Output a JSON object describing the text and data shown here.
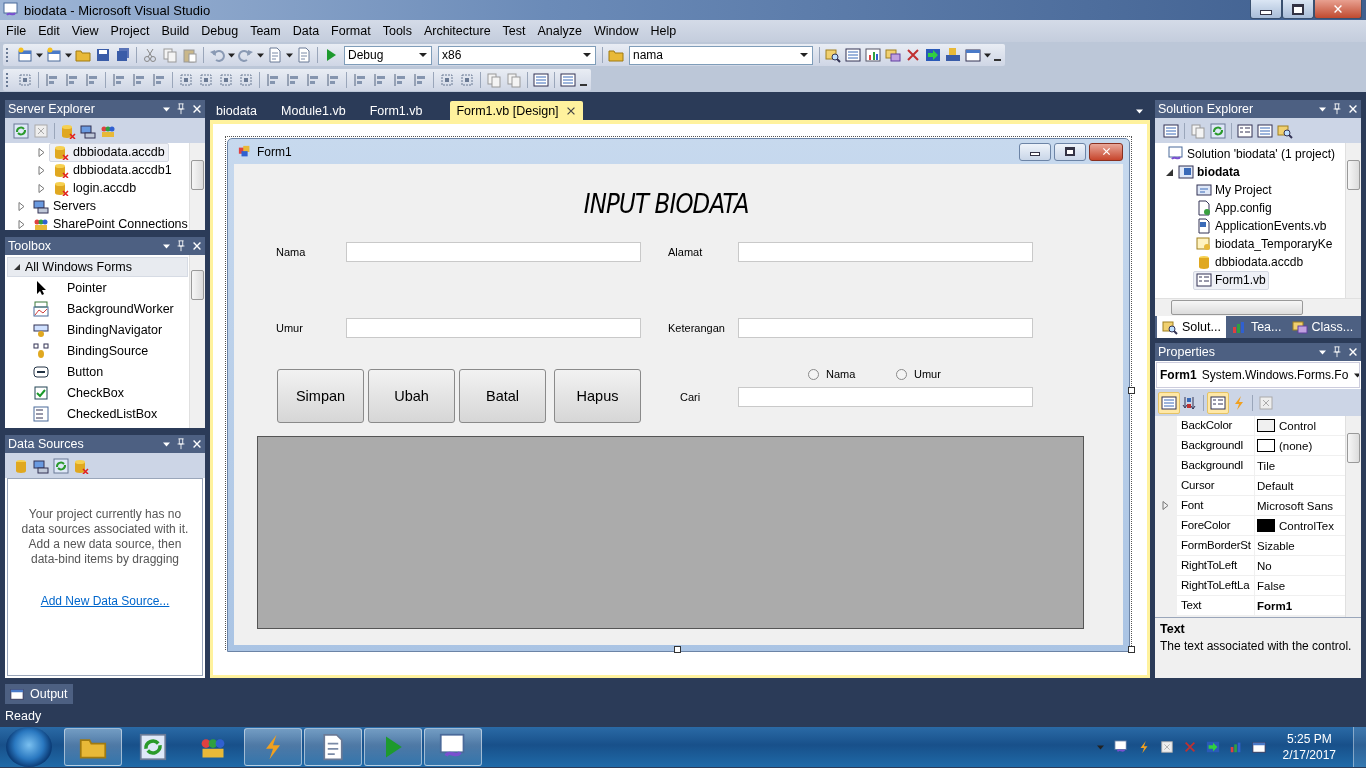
{
  "window": {
    "title": "biodata - Microsoft Visual Studio"
  },
  "menu": [
    "File",
    "Edit",
    "View",
    "Project",
    "Build",
    "Debug",
    "Team",
    "Data",
    "Format",
    "Tools",
    "Architecture",
    "Test",
    "Analyze",
    "Window",
    "Help"
  ],
  "toolbar": {
    "configuration": "Debug",
    "platform": "x86",
    "find": "nama"
  },
  "server_explorer": {
    "title": "Server Explorer",
    "items": [
      {
        "children": [
          {
            "label": "dbbiodata.accdb",
            "kind": "database",
            "expanded": false,
            "selected": true
          },
          {
            "label": "dbbiodata.accdb1",
            "kind": "database",
            "expanded": false,
            "selected": false
          },
          {
            "label": "login.accdb",
            "kind": "database",
            "expanded": false,
            "selected": false
          }
        ]
      },
      {
        "label": "Servers",
        "kind": "servers",
        "expanded": false,
        "selected": false
      },
      {
        "label": "SharePoint Connections",
        "kind": "sharepoint",
        "expanded": false,
        "selected": false
      }
    ]
  },
  "toolbox": {
    "title": "Toolbox",
    "category": {
      "label": "All Windows Forms",
      "expanded": true
    },
    "items": [
      {
        "label": "Pointer",
        "kind": "pointer"
      },
      {
        "label": "BackgroundWorker",
        "kind": "worker"
      },
      {
        "label": "BindingNavigator",
        "kind": "navigator"
      },
      {
        "label": "BindingSource",
        "kind": "source"
      },
      {
        "label": "Button",
        "kind": "button"
      },
      {
        "label": "CheckBox",
        "kind": "checkbox"
      },
      {
        "label": "CheckedListBox",
        "kind": "listbox"
      }
    ]
  },
  "data_sources": {
    "title": "Data Sources",
    "message": "Your project currently has no data sources associated with it. Add a new data source, then data-bind items by dragging",
    "link": "Add New Data Source..."
  },
  "editor_tabs": [
    {
      "label": "biodata",
      "selected": false
    },
    {
      "label": "Module1.vb",
      "selected": false
    },
    {
      "label": "Form1.vb",
      "selected": false
    },
    {
      "label": "Form1.vb [Design]",
      "selected": true
    }
  ],
  "form": {
    "title": "Form1",
    "heading": "INPUT BIODATA",
    "fields": [
      {
        "label": "Nama"
      },
      {
        "label": "Alamat"
      },
      {
        "label": "Umur"
      },
      {
        "label": "Keterangan"
      }
    ],
    "buttons": [
      "Simpan",
      "Ubah",
      "Batal",
      "Hapus"
    ],
    "radios": [
      {
        "label": "Nama",
        "selected": false
      },
      {
        "label": "Umur",
        "selected": false
      }
    ],
    "search_label": "Cari"
  },
  "solution_explorer": {
    "title": "Solution Explorer",
    "items": [
      {
        "label": "Solution 'biodata' (1 project)",
        "kind": "solution",
        "selected": false,
        "children": [
          {
            "label": "biodata",
            "kind": "project",
            "expanded": true,
            "selected": false,
            "children": [
              {
                "label": "My Project",
                "kind": "myproject",
                "selected": false
              },
              {
                "label": "App.config",
                "kind": "config",
                "selected": false
              },
              {
                "label": "ApplicationEvents.vb",
                "kind": "vbfile",
                "selected": false
              },
              {
                "label": "biodata_TemporaryKe",
                "kind": "key",
                "selected": false
              },
              {
                "label": "dbbiodata.accdb",
                "kind": "database",
                "selected": false
              },
              {
                "label": "Form1.vb",
                "kind": "form",
                "selected": true
              }
            ]
          }
        ]
      }
    ],
    "tabs": [
      {
        "label": "Solut...",
        "selected": true
      },
      {
        "label": "Tea...",
        "selected": false
      },
      {
        "label": "Class...",
        "selected": false
      }
    ]
  },
  "properties": {
    "title": "Properties",
    "object": "Form1",
    "object_type": "System.Windows.Forms.Fo",
    "rows": [
      {
        "name": "BackColor",
        "value": "Control",
        "kind": "color",
        "color": "#f0f0f0"
      },
      {
        "name": "BackgroundI",
        "value": "(none)",
        "kind": "color",
        "color": "#ffffff"
      },
      {
        "name": "BackgroundI",
        "value": "Tile",
        "kind": "plain"
      },
      {
        "name": "Cursor",
        "value": "Default",
        "kind": "plain"
      },
      {
        "name": "Font",
        "value": "Microsoft Sans",
        "kind": "group",
        "expanded": false
      },
      {
        "name": "ForeColor",
        "value": "ControlTex",
        "kind": "color",
        "color": "#000000"
      },
      {
        "name": "FormBorderSt",
        "value": "Sizable",
        "kind": "plain"
      },
      {
        "name": "RightToLeft",
        "value": "No",
        "kind": "plain"
      },
      {
        "name": "RightToLeftLa",
        "value": "False",
        "kind": "plain"
      },
      {
        "name": "Text",
        "value": "Form1",
        "kind": "plain",
        "modified": true
      }
    ],
    "description_title": "Text",
    "description": "The text associated with the control."
  },
  "output_tab": "Output",
  "status_bar": "Ready",
  "taskbar": {
    "time": "5:25 PM",
    "date": "2/17/2017"
  }
}
